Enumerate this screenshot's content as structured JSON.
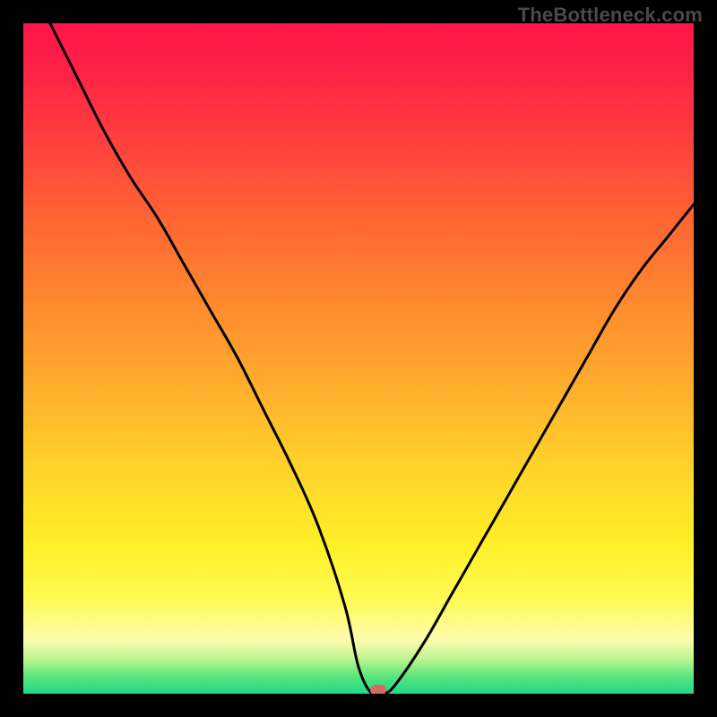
{
  "watermark": "TheBottleneck.com",
  "chart_data": {
    "type": "line",
    "title": "",
    "xlabel": "",
    "ylabel": "",
    "xlim": [
      0,
      100
    ],
    "ylim": [
      0,
      100
    ],
    "gradient_stops": [
      {
        "pos": 0,
        "color": "#ff1549"
      },
      {
        "pos": 16,
        "color": "#ff3b3e"
      },
      {
        "pos": 30,
        "color": "#ff6733"
      },
      {
        "pos": 54,
        "color": "#ffad2d"
      },
      {
        "pos": 78,
        "color": "#fff028"
      },
      {
        "pos": 92,
        "color": "#fdfcae"
      },
      {
        "pos": 97.5,
        "color": "#57e57b"
      },
      {
        "pos": 100,
        "color": "#1fd88a"
      }
    ],
    "series": [
      {
        "name": "bottleneck-curve",
        "x": [
          4,
          8,
          12,
          16,
          20,
          24,
          28,
          32,
          36,
          40,
          44,
          48,
          50,
          52,
          54,
          56,
          60,
          64,
          68,
          72,
          76,
          80,
          84,
          88,
          92,
          96,
          100
        ],
        "y": [
          100,
          92,
          84,
          77,
          71,
          64,
          57,
          50,
          42,
          34,
          25,
          13,
          4,
          0,
          0,
          2,
          8,
          15,
          22,
          29,
          36,
          43,
          50,
          57,
          63,
          68,
          73
        ]
      }
    ],
    "marker": {
      "x": 53,
      "y": 0.5,
      "color": "#d46a63"
    }
  }
}
